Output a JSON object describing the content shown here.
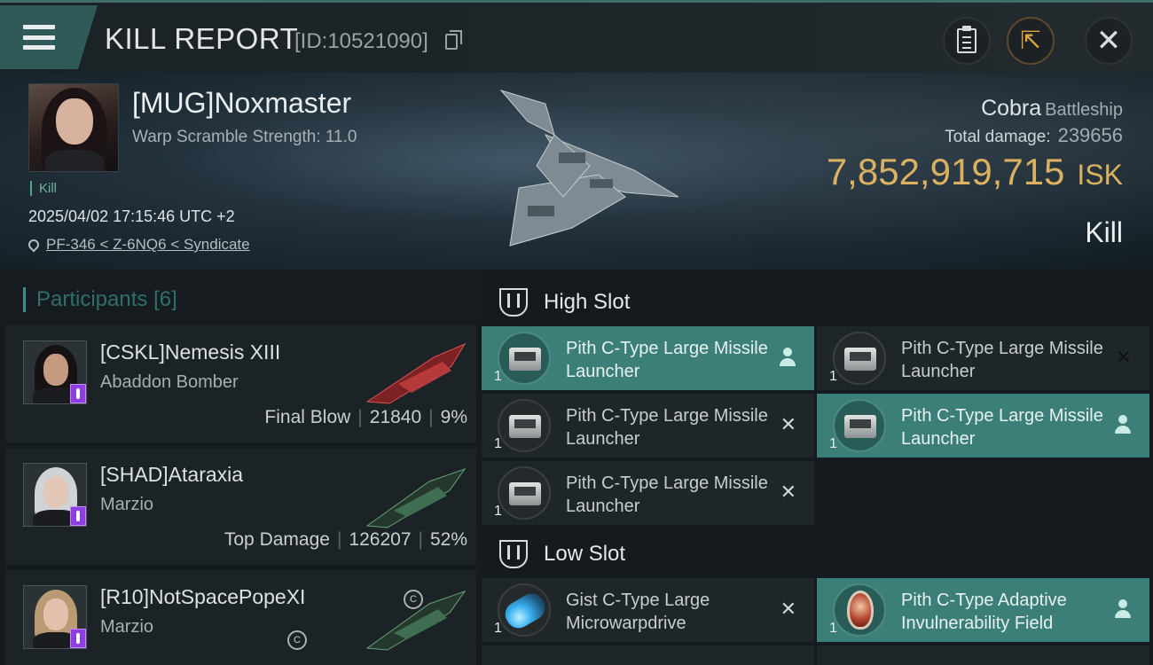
{
  "header": {
    "title": "KILL REPORT",
    "report_id": "[ID:10521090]",
    "menu_icon": "hamburger-icon",
    "buttons": {
      "clipboard_icon": "clipboard-icon",
      "share_icon": "share-icon",
      "close_icon": "close-icon",
      "close_glyph": "✕",
      "share_glyph": "⇱"
    }
  },
  "victim": {
    "name": "[MUG]Noxmaster",
    "warp_scramble": "Warp Scramble Strength: 11.0",
    "kill_tag": "Kill",
    "timestamp": "2025/04/02 17:15:46 UTC +2",
    "location": "PF-346 < Z-6NQ6 < Syndicate",
    "ship_name": "Cobra",
    "ship_class": "Battleship",
    "total_damage_label": "Total damage:",
    "total_damage": "239656",
    "isk_value": "7,852,919,715",
    "isk_unit": "ISK",
    "result": "Kill"
  },
  "participants": {
    "label": "Participants",
    "count": "[6]",
    "rows": [
      {
        "name": "[CSKL]Nemesis XIII",
        "ship": "Abaddon Bomber",
        "tag": "Final Blow",
        "damage": "21840",
        "percent": "9%",
        "sep": "|"
      },
      {
        "name": "[SHAD]Ataraxia",
        "ship": "Marzio",
        "tag": "Top Damage",
        "damage": "126207",
        "percent": "52%",
        "sep": "|"
      },
      {
        "name": "[R10]NotSpacePopeXI",
        "ship": "Marzio",
        "c_badge": "C"
      }
    ]
  },
  "fitting": {
    "high_slot": {
      "title": "High Slot",
      "modules": [
        {
          "name": "Pith C-Type Large Missile Launcher",
          "qty": "1"
        },
        {
          "name": "Pith C-Type Large Missile Launcher",
          "qty": "1",
          "state": "✕"
        },
        {
          "name": "Pith C-Type Large Missile Launcher",
          "qty": "1",
          "state": "✕"
        },
        {
          "name": "Pith C-Type Large Missile Launcher",
          "qty": "1"
        },
        {
          "name": "Pith C-Type Large Missile Launcher",
          "qty": "1",
          "state": "✕"
        }
      ]
    },
    "low_slot": {
      "title": "Low Slot",
      "modules": [
        {
          "name": "Gist C-Type Large Microwarpdrive",
          "qty": "1",
          "state": "✕"
        },
        {
          "name": "Pith C-Type Adaptive Invulnerability Field",
          "qty": "1"
        }
      ]
    }
  },
  "colors": {
    "accent": "#3b7f78",
    "isk": "#e8b55a",
    "badge": "#8f3ee0"
  }
}
